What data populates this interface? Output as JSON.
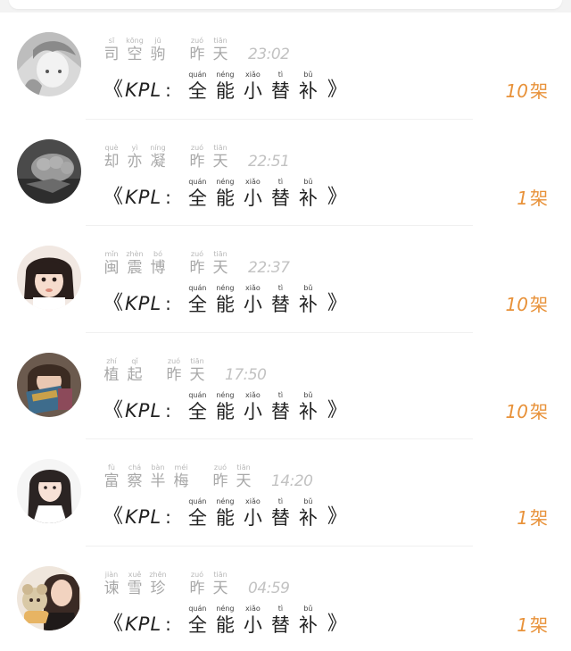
{
  "messages": [
    {
      "name": [
        {
          "hanzi": "司",
          "pinyin": "sī"
        },
        {
          "hanzi": "空",
          "pinyin": "kōng"
        },
        {
          "hanzi": "驹",
          "pinyin": "jū"
        }
      ],
      "day": [
        {
          "hanzi": "昨",
          "pinyin": "zuó"
        },
        {
          "hanzi": "天",
          "pinyin": "tiān"
        }
      ],
      "time": "23:02",
      "count": "10",
      "unit": "架",
      "avatar_icon": "anime-girl-avatar"
    },
    {
      "name": [
        {
          "hanzi": "却",
          "pinyin": "què"
        },
        {
          "hanzi": "亦",
          "pinyin": "yì"
        },
        {
          "hanzi": "凝",
          "pinyin": "níng"
        }
      ],
      "day": [
        {
          "hanzi": "昨",
          "pinyin": "zuó"
        },
        {
          "hanzi": "天",
          "pinyin": "tiān"
        }
      ],
      "time": "22:51",
      "count": "1",
      "unit": "架",
      "avatar_icon": "fist-avatar"
    },
    {
      "name": [
        {
          "hanzi": "闽",
          "pinyin": "mǐn"
        },
        {
          "hanzi": "震",
          "pinyin": "zhèn"
        },
        {
          "hanzi": "博",
          "pinyin": "bó"
        }
      ],
      "day": [
        {
          "hanzi": "昨",
          "pinyin": "zuó"
        },
        {
          "hanzi": "天",
          "pinyin": "tiān"
        }
      ],
      "time": "22:37",
      "count": "10",
      "unit": "架",
      "avatar_icon": "girl-bangs-avatar"
    },
    {
      "name": [
        {
          "hanzi": "植",
          "pinyin": "zhí"
        },
        {
          "hanzi": "起",
          "pinyin": "qǐ"
        }
      ],
      "day": [
        {
          "hanzi": "昨",
          "pinyin": "zuó"
        },
        {
          "hanzi": "天",
          "pinyin": "tiān"
        }
      ],
      "time": "17:50",
      "count": "10",
      "unit": "架",
      "avatar_icon": "girl-book-avatar"
    },
    {
      "name": [
        {
          "hanzi": "富",
          "pinyin": "fù"
        },
        {
          "hanzi": "察",
          "pinyin": "chá"
        },
        {
          "hanzi": "半",
          "pinyin": "bàn"
        },
        {
          "hanzi": "梅",
          "pinyin": "méi"
        }
      ],
      "day": [
        {
          "hanzi": "昨",
          "pinyin": "zuó"
        },
        {
          "hanzi": "天",
          "pinyin": "tiān"
        }
      ],
      "time": "14:20",
      "count": "1",
      "unit": "架",
      "avatar_icon": "girl-long-hair-avatar"
    },
    {
      "name": [
        {
          "hanzi": "谏",
          "pinyin": "jiàn"
        },
        {
          "hanzi": "雪",
          "pinyin": "xuě"
        },
        {
          "hanzi": "珍",
          "pinyin": "zhēn"
        }
      ],
      "day": [
        {
          "hanzi": "昨",
          "pinyin": "zuó"
        },
        {
          "hanzi": "天",
          "pinyin": "tiān"
        }
      ],
      "time": "04:59",
      "count": "1",
      "unit": "架",
      "avatar_icon": "girl-plush-toy-avatar"
    }
  ],
  "game_title": {
    "open_bracket": "《",
    "prefix": "KPL",
    "colon": ":",
    "chars": [
      {
        "hanzi": "全",
        "pinyin": "quán"
      },
      {
        "hanzi": "能",
        "pinyin": "néng"
      },
      {
        "hanzi": "小",
        "pinyin": "xiǎo"
      },
      {
        "hanzi": "替",
        "pinyin": "tì"
      },
      {
        "hanzi": "补",
        "pinyin": "bǔ"
      }
    ],
    "close_bracket": "》"
  },
  "colors": {
    "count_accent": "#e8923a",
    "name_gray": "#a8a8a8",
    "title_black": "#222222"
  }
}
